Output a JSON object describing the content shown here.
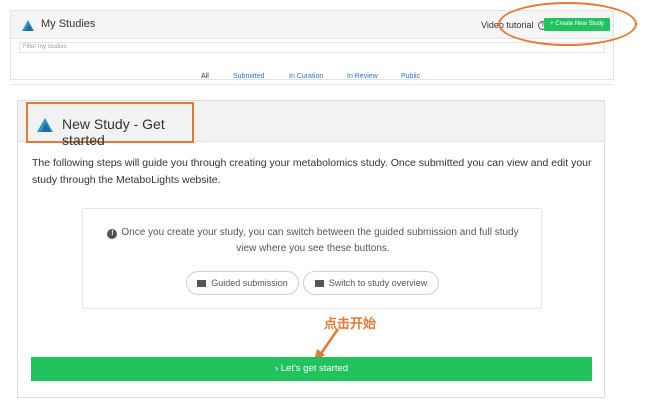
{
  "studies": {
    "title": "My Studies",
    "video_tutorial": "Video tutorial",
    "help_symbol": "?",
    "create_button": "+ Create New Study",
    "filter_placeholder": "Filter my studies",
    "tabs": [
      {
        "label": "All"
      },
      {
        "label": "Submitted"
      },
      {
        "label": "In Curation"
      },
      {
        "label": "In Review"
      },
      {
        "label": "Public"
      }
    ]
  },
  "new_study": {
    "title": "New Study - Get started",
    "intro": "The following steps will guide you through creating your metabolomics study. Once submitted you can view and edit your study through the MetaboLights website.",
    "info_text": "Once you create your study, you can switch between the guided submission and full study view where you see these buttons.",
    "guided_button": "Guided submission",
    "overview_button": "Switch to study overview",
    "annotation": "点击开始",
    "start_button": "› Let's get started"
  },
  "colors": {
    "accent_green": "#22c35e",
    "annotation_orange": "#e07a34",
    "link_blue": "#2f74c0"
  },
  "icons": [
    "metabolights-logo-icon",
    "help-circle-icon",
    "info-icon",
    "guided-submission-icon",
    "study-overview-icon",
    "annotation-arrow-icon"
  ]
}
